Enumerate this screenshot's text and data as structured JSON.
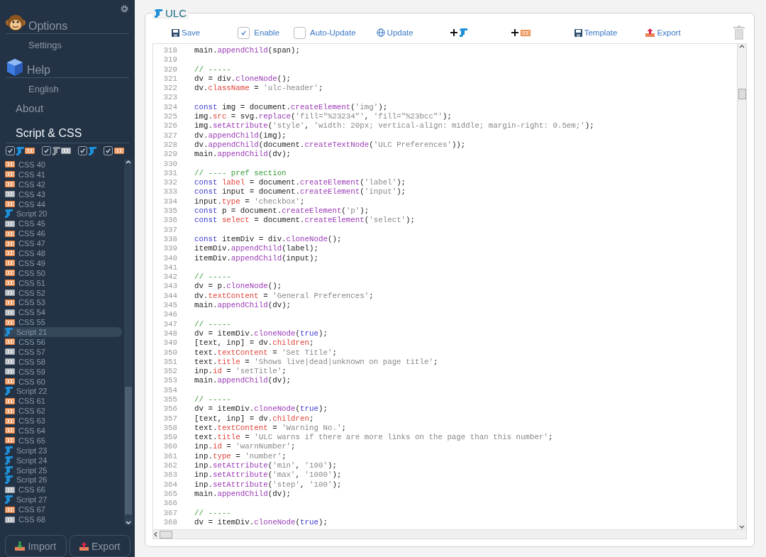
{
  "sidebar": {
    "nav": [
      {
        "kind": "heading",
        "label": "Options"
      },
      {
        "kind": "sub",
        "label": "Settings"
      },
      {
        "kind": "heading",
        "label": "Help"
      },
      {
        "kind": "sub",
        "label": "English"
      },
      {
        "kind": "link",
        "label": "About"
      },
      {
        "kind": "section",
        "label": "Script & CSS"
      }
    ],
    "filters": [
      {
        "kind": "enabled",
        "checked": true
      },
      {
        "kind": "disabled",
        "checked": true
      },
      {
        "kind": "script",
        "checked": true
      },
      {
        "kind": "css",
        "checked": true
      }
    ],
    "items": [
      {
        "kind": "css",
        "label": "CSS 40",
        "enabled": true,
        "selected": false
      },
      {
        "kind": "css",
        "label": "CSS 41",
        "enabled": true,
        "selected": false
      },
      {
        "kind": "css",
        "label": "CSS 42",
        "enabled": true,
        "selected": false
      },
      {
        "kind": "css",
        "label": "CSS 43",
        "enabled": false,
        "selected": false
      },
      {
        "kind": "css",
        "label": "CSS 44",
        "enabled": true,
        "selected": false
      },
      {
        "kind": "script",
        "label": "Script 20",
        "enabled": true,
        "selected": false
      },
      {
        "kind": "css",
        "label": "CSS 45",
        "enabled": false,
        "selected": false
      },
      {
        "kind": "css",
        "label": "CSS 46",
        "enabled": true,
        "selected": false
      },
      {
        "kind": "css",
        "label": "CSS 47",
        "enabled": true,
        "selected": false
      },
      {
        "kind": "css",
        "label": "CSS 48",
        "enabled": true,
        "selected": false
      },
      {
        "kind": "css",
        "label": "CSS 49",
        "enabled": true,
        "selected": false
      },
      {
        "kind": "css",
        "label": "CSS 50",
        "enabled": true,
        "selected": false
      },
      {
        "kind": "css",
        "label": "CSS 51",
        "enabled": true,
        "selected": false
      },
      {
        "kind": "css",
        "label": "CSS 52",
        "enabled": false,
        "selected": false
      },
      {
        "kind": "css",
        "label": "CSS 53",
        "enabled": true,
        "selected": false
      },
      {
        "kind": "css",
        "label": "CSS 54",
        "enabled": false,
        "selected": false
      },
      {
        "kind": "css",
        "label": "CSS 55",
        "enabled": true,
        "selected": false
      },
      {
        "kind": "script",
        "label": "Script 21",
        "enabled": true,
        "selected": true
      },
      {
        "kind": "css",
        "label": "CSS 56",
        "enabled": true,
        "selected": false
      },
      {
        "kind": "css",
        "label": "CSS 57",
        "enabled": false,
        "selected": false
      },
      {
        "kind": "css",
        "label": "CSS 58",
        "enabled": false,
        "selected": false
      },
      {
        "kind": "css",
        "label": "CSS 59",
        "enabled": false,
        "selected": false
      },
      {
        "kind": "css",
        "label": "CSS 60",
        "enabled": true,
        "selected": false
      },
      {
        "kind": "script",
        "label": "Script 22",
        "enabled": true,
        "selected": false
      },
      {
        "kind": "css",
        "label": "CSS 61",
        "enabled": true,
        "selected": false
      },
      {
        "kind": "css",
        "label": "CSS 62",
        "enabled": true,
        "selected": false
      },
      {
        "kind": "css",
        "label": "CSS 63",
        "enabled": true,
        "selected": false
      },
      {
        "kind": "css",
        "label": "CSS 64",
        "enabled": true,
        "selected": false
      },
      {
        "kind": "css",
        "label": "CSS 65",
        "enabled": true,
        "selected": false
      },
      {
        "kind": "script",
        "label": "Script 23",
        "enabled": true,
        "selected": false
      },
      {
        "kind": "script",
        "label": "Script 24",
        "enabled": true,
        "selected": false
      },
      {
        "kind": "script",
        "label": "Script 25",
        "enabled": true,
        "selected": false
      },
      {
        "kind": "script",
        "label": "Script 26",
        "enabled": true,
        "selected": false
      },
      {
        "kind": "css",
        "label": "CSS 66",
        "enabled": false,
        "selected": false
      },
      {
        "kind": "script",
        "label": "Script 27",
        "enabled": true,
        "selected": false
      },
      {
        "kind": "css",
        "label": "CSS 67",
        "enabled": true,
        "selected": false
      },
      {
        "kind": "css",
        "label": "CSS 68",
        "enabled": false,
        "selected": false
      }
    ],
    "buttons": [
      {
        "kind": "import",
        "label": "Import"
      },
      {
        "kind": "export",
        "label": "Export"
      }
    ]
  },
  "editor": {
    "title": "ULC",
    "toolbar": [
      {
        "kind": "save",
        "label": "Save"
      },
      {
        "kind": "checkbox",
        "label": "Enable",
        "checked": true
      },
      {
        "kind": "checkbox",
        "label": "Auto-Update",
        "checked": false
      },
      {
        "kind": "update",
        "label": "Update"
      },
      {
        "kind": "addscript"
      },
      {
        "kind": "addcss"
      },
      {
        "kind": "save",
        "label": "Template"
      },
      {
        "kind": "export",
        "label": "Export"
      },
      {
        "kind": "trash"
      }
    ],
    "lines": [
      {
        "n": "318",
        "t": [
          {
            "kind": "plain",
            "text": "main."
          },
          {
            "kind": "func",
            "text": "appendChild"
          },
          {
            "kind": "plain",
            "text": "(span);"
          }
        ]
      },
      {
        "n": "319"
      },
      {
        "n": "320",
        "t": [
          {
            "kind": "comment",
            "text": "// -----"
          }
        ]
      },
      {
        "n": "321",
        "t": [
          {
            "kind": "plain",
            "text": "dv = div."
          },
          {
            "kind": "func",
            "text": "cloneNode"
          },
          {
            "kind": "plain",
            "text": "();"
          }
        ]
      },
      {
        "n": "322",
        "t": [
          {
            "kind": "plain",
            "text": "dv."
          },
          {
            "kind": "attr",
            "text": "className"
          },
          {
            "kind": "plain",
            "text": " = "
          },
          {
            "kind": "str",
            "text": "'ulc-header'"
          },
          {
            "kind": "plain",
            "text": ";"
          }
        ]
      },
      {
        "n": "323"
      },
      {
        "n": "324",
        "t": [
          {
            "kind": "keyword",
            "text": "const"
          },
          {
            "kind": "plain",
            "text": " img = document."
          },
          {
            "kind": "func",
            "text": "createElement"
          },
          {
            "kind": "plain",
            "text": "("
          },
          {
            "kind": "str",
            "text": "'img'"
          },
          {
            "kind": "plain",
            "text": ");"
          }
        ]
      },
      {
        "n": "325",
        "t": [
          {
            "kind": "plain",
            "text": "img."
          },
          {
            "kind": "attr",
            "text": "src"
          },
          {
            "kind": "plain",
            "text": " = svg."
          },
          {
            "kind": "func",
            "text": "replace"
          },
          {
            "kind": "plain",
            "text": "("
          },
          {
            "kind": "str",
            "text": "'fill=\"%23234\"'"
          },
          {
            "kind": "plain",
            "text": ", "
          },
          {
            "kind": "str",
            "text": "'fill=\"%23bcc\"'"
          },
          {
            "kind": "plain",
            "text": ");"
          }
        ]
      },
      {
        "n": "326",
        "t": [
          {
            "kind": "plain",
            "text": "img."
          },
          {
            "kind": "func",
            "text": "setAttribute"
          },
          {
            "kind": "plain",
            "text": "("
          },
          {
            "kind": "str",
            "text": "'style'"
          },
          {
            "kind": "plain",
            "text": ", "
          },
          {
            "kind": "str",
            "text": "'width: 20px; vertical-align: middle; margin-right: 0.5em;'"
          },
          {
            "kind": "plain",
            "text": ");"
          }
        ]
      },
      {
        "n": "327",
        "t": [
          {
            "kind": "plain",
            "text": "dv."
          },
          {
            "kind": "func",
            "text": "appendChild"
          },
          {
            "kind": "plain",
            "text": "(img);"
          }
        ]
      },
      {
        "n": "328",
        "t": [
          {
            "kind": "plain",
            "text": "dv."
          },
          {
            "kind": "func",
            "text": "appendChild"
          },
          {
            "kind": "plain",
            "text": "(document."
          },
          {
            "kind": "func",
            "text": "createTextNode"
          },
          {
            "kind": "plain",
            "text": "("
          },
          {
            "kind": "str",
            "text": "'ULC Preferences'"
          },
          {
            "kind": "plain",
            "text": "));"
          }
        ]
      },
      {
        "n": "329",
        "t": [
          {
            "kind": "plain",
            "text": "main."
          },
          {
            "kind": "func",
            "text": "appendChild"
          },
          {
            "kind": "plain",
            "text": "(dv);"
          }
        ]
      },
      {
        "n": "330"
      },
      {
        "n": "331",
        "t": [
          {
            "kind": "comment",
            "text": "// ---- pref section"
          }
        ]
      },
      {
        "n": "332",
        "t": [
          {
            "kind": "keyword",
            "text": "const"
          },
          {
            "kind": "attr",
            "text": " label"
          },
          {
            "kind": "plain",
            "text": " = document."
          },
          {
            "kind": "func",
            "text": "createElement"
          },
          {
            "kind": "plain",
            "text": "("
          },
          {
            "kind": "str",
            "text": "'label'"
          },
          {
            "kind": "plain",
            "text": ");"
          }
        ]
      },
      {
        "n": "333",
        "t": [
          {
            "kind": "keyword",
            "text": "const"
          },
          {
            "kind": "plain",
            "text": " input = document."
          },
          {
            "kind": "func",
            "text": "createElement"
          },
          {
            "kind": "plain",
            "text": "("
          },
          {
            "kind": "str",
            "text": "'input'"
          },
          {
            "kind": "plain",
            "text": ");"
          }
        ]
      },
      {
        "n": "334",
        "t": [
          {
            "kind": "plain",
            "text": "input."
          },
          {
            "kind": "attr",
            "text": "type"
          },
          {
            "kind": "plain",
            "text": " = "
          },
          {
            "kind": "str",
            "text": "'checkbox'"
          },
          {
            "kind": "plain",
            "text": ";"
          }
        ]
      },
      {
        "n": "335",
        "t": [
          {
            "kind": "keyword",
            "text": "const"
          },
          {
            "kind": "plain",
            "text": " p = document."
          },
          {
            "kind": "func",
            "text": "createElement"
          },
          {
            "kind": "plain",
            "text": "("
          },
          {
            "kind": "str",
            "text": "'p'"
          },
          {
            "kind": "plain",
            "text": ");"
          }
        ]
      },
      {
        "n": "336",
        "t": [
          {
            "kind": "keyword",
            "text": "const"
          },
          {
            "kind": "attr",
            "text": " select"
          },
          {
            "kind": "plain",
            "text": " = document."
          },
          {
            "kind": "func",
            "text": "createElement"
          },
          {
            "kind": "plain",
            "text": "("
          },
          {
            "kind": "str",
            "text": "'select'"
          },
          {
            "kind": "plain",
            "text": ");"
          }
        ]
      },
      {
        "n": "337"
      },
      {
        "n": "338",
        "t": [
          {
            "kind": "keyword",
            "text": "const"
          },
          {
            "kind": "plain",
            "text": " itemDiv = div."
          },
          {
            "kind": "func",
            "text": "cloneNode"
          },
          {
            "kind": "plain",
            "text": "();"
          }
        ]
      },
      {
        "n": "339",
        "t": [
          {
            "kind": "plain",
            "text": "itemDiv."
          },
          {
            "kind": "func",
            "text": "appendChild"
          },
          {
            "kind": "plain",
            "text": "(label);"
          }
        ]
      },
      {
        "n": "340",
        "t": [
          {
            "kind": "plain",
            "text": "itemDiv."
          },
          {
            "kind": "func",
            "text": "appendChild"
          },
          {
            "kind": "plain",
            "text": "(input);"
          }
        ]
      },
      {
        "n": "341"
      },
      {
        "n": "342",
        "t": [
          {
            "kind": "comment",
            "text": "// -----"
          }
        ]
      },
      {
        "n": "343",
        "t": [
          {
            "kind": "plain",
            "text": "dv = p."
          },
          {
            "kind": "func",
            "text": "cloneNode"
          },
          {
            "kind": "plain",
            "text": "();"
          }
        ]
      },
      {
        "n": "344",
        "t": [
          {
            "kind": "plain",
            "text": "dv."
          },
          {
            "kind": "attr",
            "text": "textContent"
          },
          {
            "kind": "plain",
            "text": " = "
          },
          {
            "kind": "str",
            "text": "'General Preferences'"
          },
          {
            "kind": "plain",
            "text": ";"
          }
        ]
      },
      {
        "n": "345",
        "t": [
          {
            "kind": "plain",
            "text": "main."
          },
          {
            "kind": "func",
            "text": "appendChild"
          },
          {
            "kind": "plain",
            "text": "(dv);"
          }
        ]
      },
      {
        "n": "346"
      },
      {
        "n": "347",
        "t": [
          {
            "kind": "comment",
            "text": "// -----"
          }
        ]
      },
      {
        "n": "348",
        "t": [
          {
            "kind": "plain",
            "text": "dv = itemDiv."
          },
          {
            "kind": "func",
            "text": "cloneNode"
          },
          {
            "kind": "plain",
            "text": "("
          },
          {
            "kind": "keyword",
            "text": "true"
          },
          {
            "kind": "plain",
            "text": ");"
          }
        ]
      },
      {
        "n": "349",
        "t": [
          {
            "kind": "plain",
            "text": "[text, inp] = dv."
          },
          {
            "kind": "attr",
            "text": "children"
          },
          {
            "kind": "plain",
            "text": ";"
          }
        ]
      },
      {
        "n": "350",
        "t": [
          {
            "kind": "plain",
            "text": "text."
          },
          {
            "kind": "attr",
            "text": "textContent"
          },
          {
            "kind": "plain",
            "text": " = "
          },
          {
            "kind": "str",
            "text": "'Set Title'"
          },
          {
            "kind": "plain",
            "text": ";"
          }
        ]
      },
      {
        "n": "351",
        "t": [
          {
            "kind": "plain",
            "text": "text."
          },
          {
            "kind": "attr",
            "text": "title"
          },
          {
            "kind": "plain",
            "text": " = "
          },
          {
            "kind": "str",
            "text": "'Shows live|dead|unknown on page title'"
          },
          {
            "kind": "plain",
            "text": ";"
          }
        ]
      },
      {
        "n": "352",
        "t": [
          {
            "kind": "plain",
            "text": "inp."
          },
          {
            "kind": "attr",
            "text": "id"
          },
          {
            "kind": "plain",
            "text": " = "
          },
          {
            "kind": "str",
            "text": "'setTitle'"
          },
          {
            "kind": "plain",
            "text": ";"
          }
        ]
      },
      {
        "n": "353",
        "t": [
          {
            "kind": "plain",
            "text": "main."
          },
          {
            "kind": "func",
            "text": "appendChild"
          },
          {
            "kind": "plain",
            "text": "(dv);"
          }
        ]
      },
      {
        "n": "354"
      },
      {
        "n": "355",
        "t": [
          {
            "kind": "comment",
            "text": "// -----"
          }
        ]
      },
      {
        "n": "356",
        "t": [
          {
            "kind": "plain",
            "text": "dv = itemDiv."
          },
          {
            "kind": "func",
            "text": "cloneNode"
          },
          {
            "kind": "plain",
            "text": "("
          },
          {
            "kind": "keyword",
            "text": "true"
          },
          {
            "kind": "plain",
            "text": ");"
          }
        ]
      },
      {
        "n": "357",
        "t": [
          {
            "kind": "plain",
            "text": "[text, inp] = dv."
          },
          {
            "kind": "attr",
            "text": "children"
          },
          {
            "kind": "plain",
            "text": ";"
          }
        ]
      },
      {
        "n": "358",
        "t": [
          {
            "kind": "plain",
            "text": "text."
          },
          {
            "kind": "attr",
            "text": "textContent"
          },
          {
            "kind": "plain",
            "text": " = "
          },
          {
            "kind": "str",
            "text": "'Warning No.'"
          },
          {
            "kind": "plain",
            "text": ";"
          }
        ]
      },
      {
        "n": "359",
        "t": [
          {
            "kind": "plain",
            "text": "text."
          },
          {
            "kind": "attr",
            "text": "title"
          },
          {
            "kind": "plain",
            "text": " = "
          },
          {
            "kind": "str",
            "text": "'ULC warns if there are more links on the page than this number'"
          },
          {
            "kind": "plain",
            "text": ";"
          }
        ]
      },
      {
        "n": "360",
        "t": [
          {
            "kind": "plain",
            "text": "inp."
          },
          {
            "kind": "attr",
            "text": "id"
          },
          {
            "kind": "plain",
            "text": " = "
          },
          {
            "kind": "str",
            "text": "'warnNumber'"
          },
          {
            "kind": "plain",
            "text": ";"
          }
        ]
      },
      {
        "n": "361",
        "t": [
          {
            "kind": "plain",
            "text": "inp."
          },
          {
            "kind": "attr",
            "text": "type"
          },
          {
            "kind": "plain",
            "text": " = "
          },
          {
            "kind": "str",
            "text": "'number'"
          },
          {
            "kind": "plain",
            "text": ";"
          }
        ]
      },
      {
        "n": "362",
        "t": [
          {
            "kind": "plain",
            "text": "inp."
          },
          {
            "kind": "func",
            "text": "setAttribute"
          },
          {
            "kind": "plain",
            "text": "("
          },
          {
            "kind": "str",
            "text": "'min'"
          },
          {
            "kind": "plain",
            "text": ", "
          },
          {
            "kind": "str",
            "text": "'100'"
          },
          {
            "kind": "plain",
            "text": ");"
          }
        ]
      },
      {
        "n": "363",
        "t": [
          {
            "kind": "plain",
            "text": "inp."
          },
          {
            "kind": "func",
            "text": "setAttribute"
          },
          {
            "kind": "plain",
            "text": "("
          },
          {
            "kind": "str",
            "text": "'max'"
          },
          {
            "kind": "plain",
            "text": ", "
          },
          {
            "kind": "str",
            "text": "'1000'"
          },
          {
            "kind": "plain",
            "text": ");"
          }
        ]
      },
      {
        "n": "364",
        "t": [
          {
            "kind": "plain",
            "text": "inp."
          },
          {
            "kind": "func",
            "text": "setAttribute"
          },
          {
            "kind": "plain",
            "text": "("
          },
          {
            "kind": "str",
            "text": "'step'"
          },
          {
            "kind": "plain",
            "text": ", "
          },
          {
            "kind": "str",
            "text": "'100'"
          },
          {
            "kind": "plain",
            "text": ");"
          }
        ]
      },
      {
        "n": "365",
        "t": [
          {
            "kind": "plain",
            "text": "main."
          },
          {
            "kind": "func",
            "text": "appendChild"
          },
          {
            "kind": "plain",
            "text": "(dv);"
          }
        ]
      },
      {
        "n": "366"
      },
      {
        "n": "367",
        "t": [
          {
            "kind": "comment",
            "text": "// -----"
          }
        ]
      },
      {
        "n": "368",
        "t": [
          {
            "kind": "plain",
            "text": "dv = itemDiv."
          },
          {
            "kind": "func",
            "text": "cloneNode"
          },
          {
            "kind": "plain",
            "text": "("
          },
          {
            "kind": "keyword",
            "text": "true"
          },
          {
            "kind": "plain",
            "text": ");"
          }
        ]
      }
    ]
  }
}
